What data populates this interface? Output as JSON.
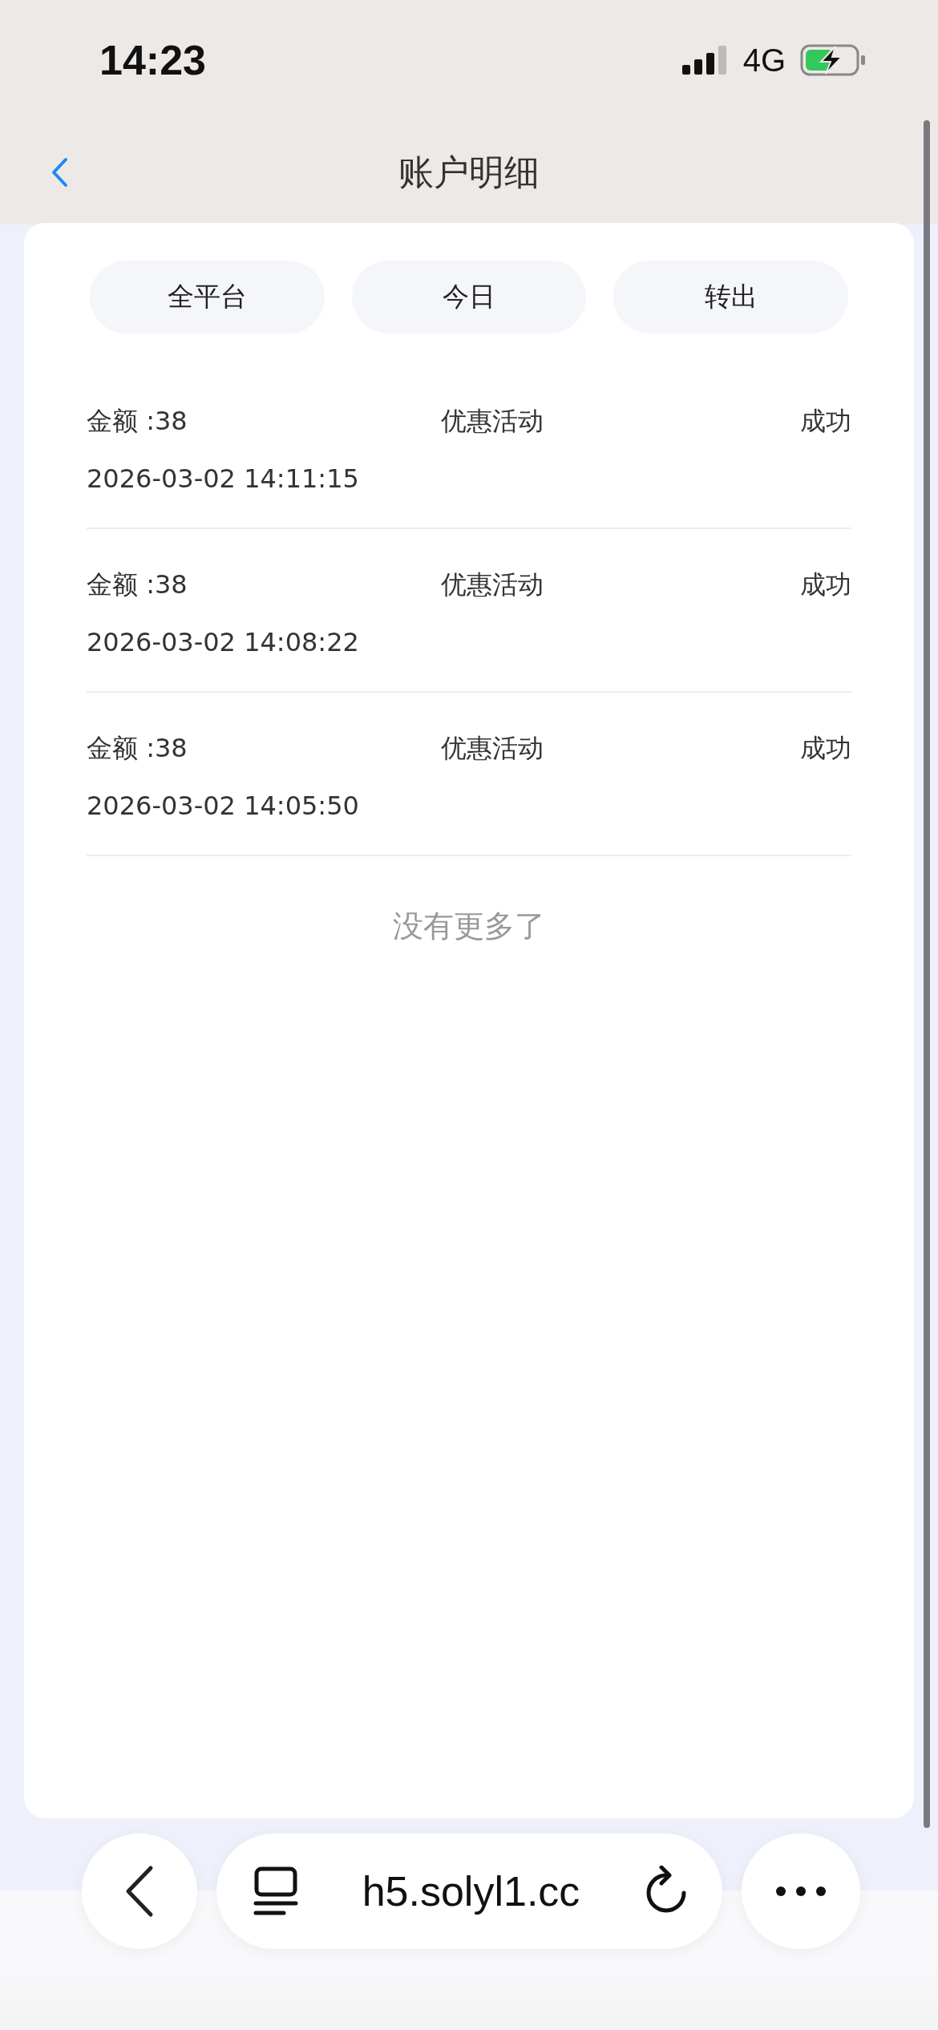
{
  "status_bar": {
    "time": "14:23",
    "network": "4G",
    "charging": true
  },
  "nav": {
    "title": "账户明细"
  },
  "filters": [
    {
      "label": "全平台",
      "selected": false
    },
    {
      "label": "今日",
      "selected": false
    },
    {
      "label": "转出",
      "selected": false
    }
  ],
  "records": [
    {
      "amount": "金额 :38",
      "type": "优惠活动",
      "status": "成功",
      "time": "2026-03-02 14:11:15"
    },
    {
      "amount": "金额 :38",
      "type": "优惠活动",
      "status": "成功",
      "time": "2026-03-02 14:08:22"
    },
    {
      "amount": "金额 :38",
      "type": "优惠活动",
      "status": "成功",
      "time": "2026-03-02 14:05:50"
    }
  ],
  "end_note": "没有更多了",
  "browser_bar": {
    "url": "h5.solyl1.cc"
  }
}
